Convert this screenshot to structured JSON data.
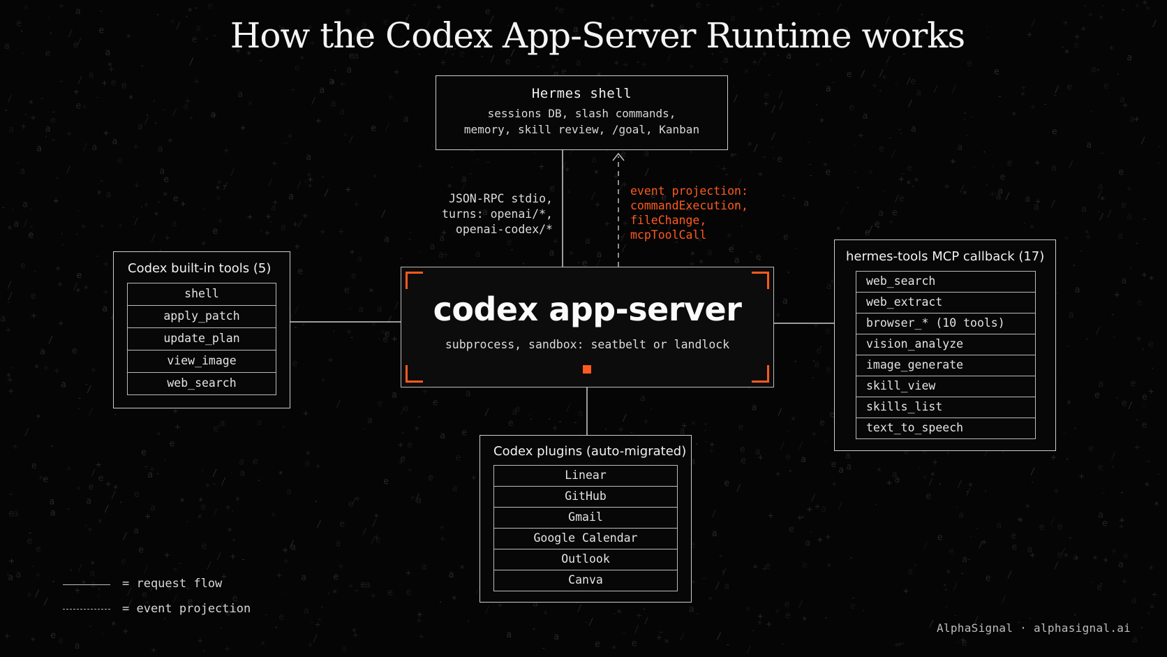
{
  "title": "How the Codex App-Server Runtime works",
  "hermes_shell": {
    "title": "Hermes shell",
    "desc_line1": "sessions DB, slash commands,",
    "desc_line2": "memory, skill review, /goal, Kanban"
  },
  "request_label": [
    "JSON-RPC stdio,",
    "turns: openai/*,",
    "openai-codex/*"
  ],
  "event_label": [
    "event projection:",
    "commandExecution,",
    "fileChange,",
    "mcpToolCall"
  ],
  "app_server": {
    "title": "codex app-server",
    "subtitle": "subprocess, sandbox: seatbelt or landlock"
  },
  "builtin_tools": {
    "title": "Codex built-in tools (5)",
    "items": [
      "shell",
      "apply_patch",
      "update_plan",
      "view_image",
      "web_search"
    ]
  },
  "mcp_tools": {
    "title": "hermes-tools MCP callback (17)",
    "items": [
      "web_search",
      "web_extract",
      "browser_* (10 tools)",
      "vision_analyze",
      "image_generate",
      "skill_view",
      "skills_list",
      "text_to_speech"
    ]
  },
  "plugins": {
    "title": "Codex plugins (auto-migrated)",
    "items": [
      "Linear",
      "GitHub",
      "Gmail",
      "Google Calendar",
      "Outlook",
      "Canva"
    ]
  },
  "legend": {
    "request": "= request flow",
    "event": "= event projection"
  },
  "footer": "AlphaSignal · alphasignal.ai",
  "colors": {
    "accent": "#ff5a1f",
    "background": "#050505",
    "line": "#bdbdbd"
  }
}
